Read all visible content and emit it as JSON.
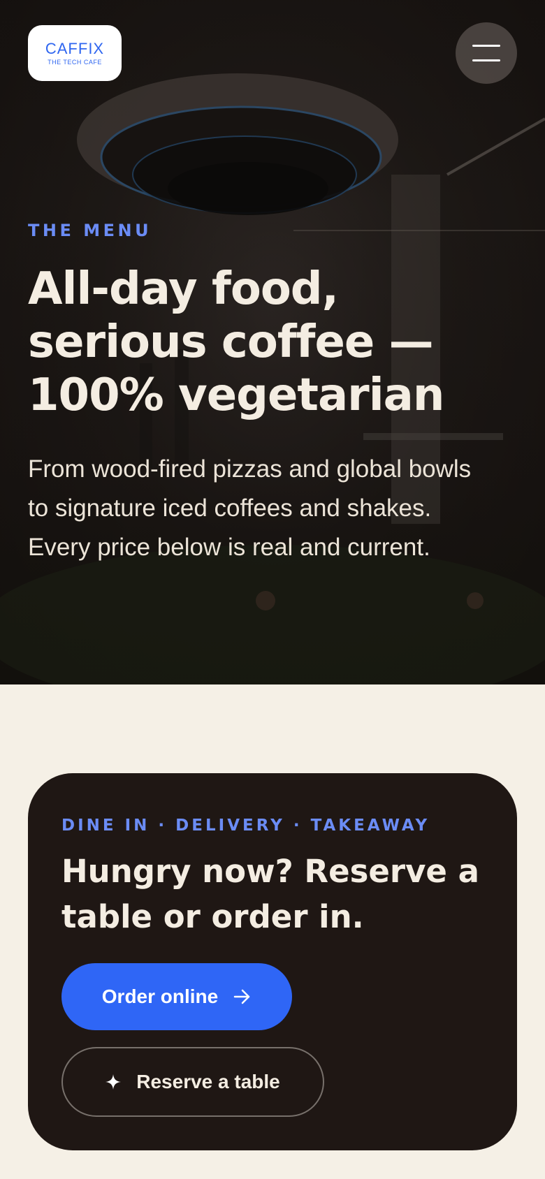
{
  "header": {
    "logo": {
      "name": "CAFFIX",
      "tagline": "THE TECH CAFE"
    },
    "menu_icon": "hamburger-menu-icon"
  },
  "hero": {
    "eyebrow": "THE MENU",
    "title": "All-day food, serious coffee — 100% vegetarian",
    "description": "From wood-fired pizzas and global bowls to signature iced coffees and shakes. Every price below is real and current."
  },
  "cta": {
    "eyebrow": "DINE IN · DELIVERY · TAKEAWAY",
    "title": "Hungry now? Reserve a table or order in.",
    "order_button": {
      "label": "Order online",
      "icon": "arrow-right-icon"
    },
    "reserve_button": {
      "label": "Reserve a table",
      "icon": "sparkle-icon"
    }
  },
  "colors": {
    "accent_blue": "#2f66f6",
    "eyebrow_blue": "#6b8cf5",
    "cream_background": "#f5f0e6",
    "dark_card": "#1f1714",
    "hero_text": "#f4ede2"
  }
}
